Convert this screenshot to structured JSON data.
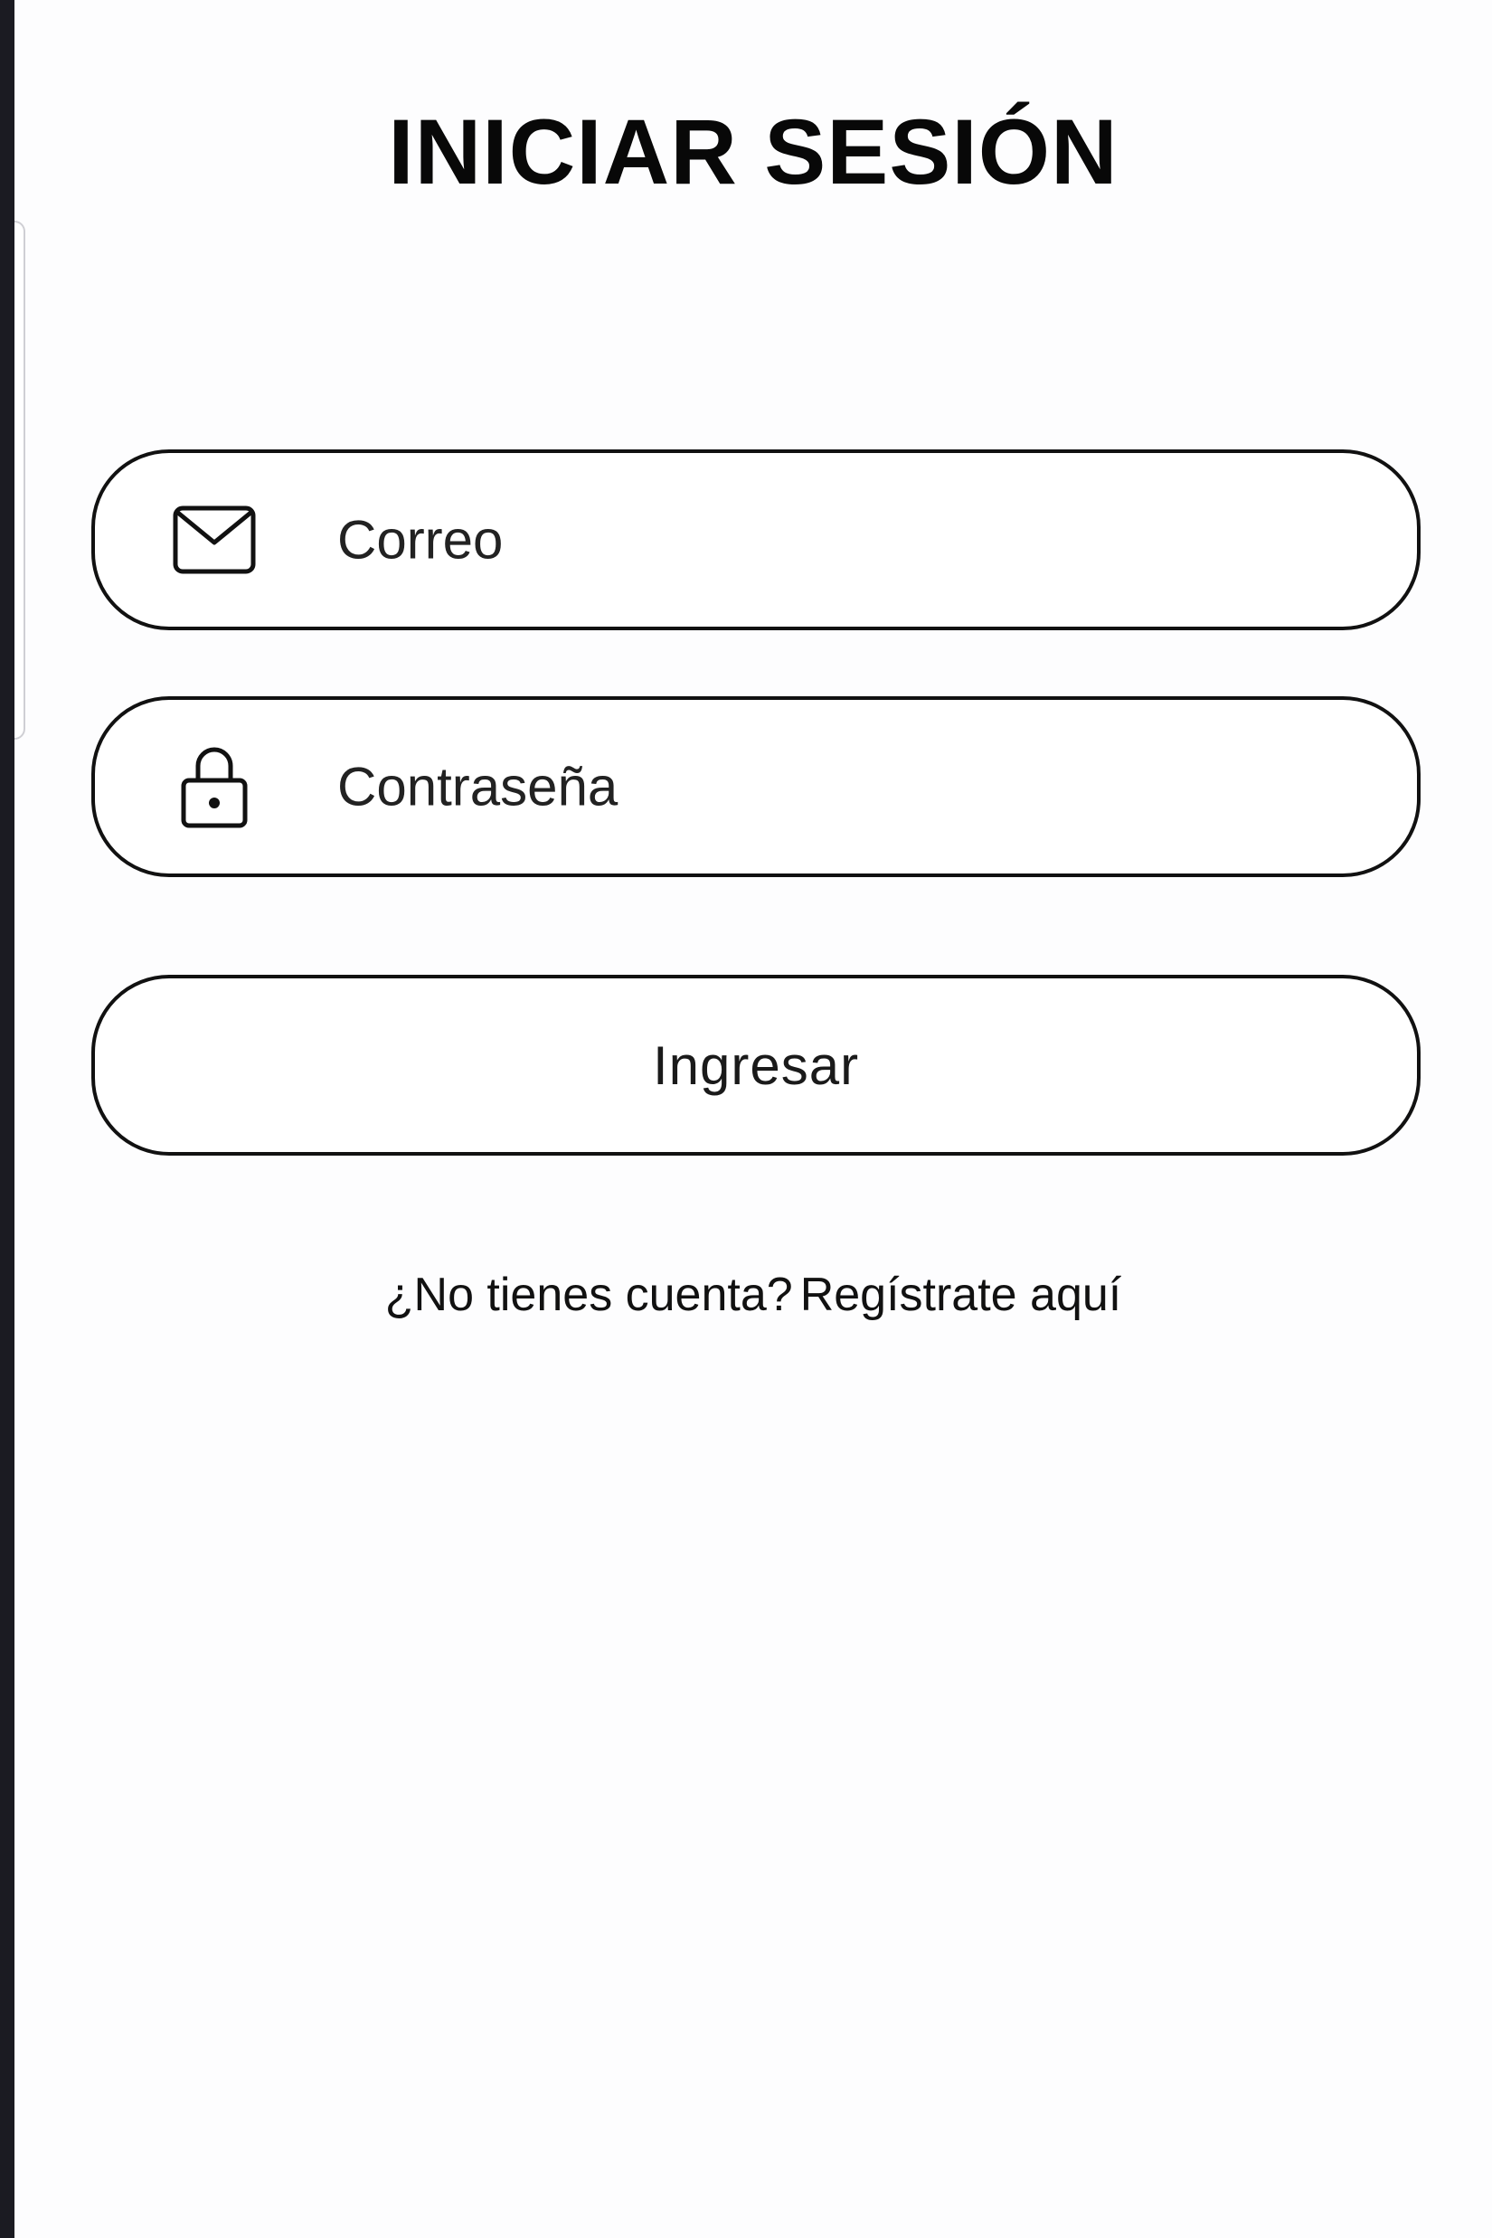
{
  "login": {
    "title": "INICIAR SESIÓN",
    "email_placeholder": "Correo",
    "password_placeholder": "Contraseña",
    "submit_label": "Ingresar",
    "signup_prompt": "¿No tienes cuenta?",
    "signup_link": "Regístrate aquí"
  },
  "icons": {
    "email": "envelope-icon",
    "password": "lock-icon"
  },
  "colors": {
    "text": "#111111",
    "border": "#111111",
    "background": "#ffffff"
  }
}
